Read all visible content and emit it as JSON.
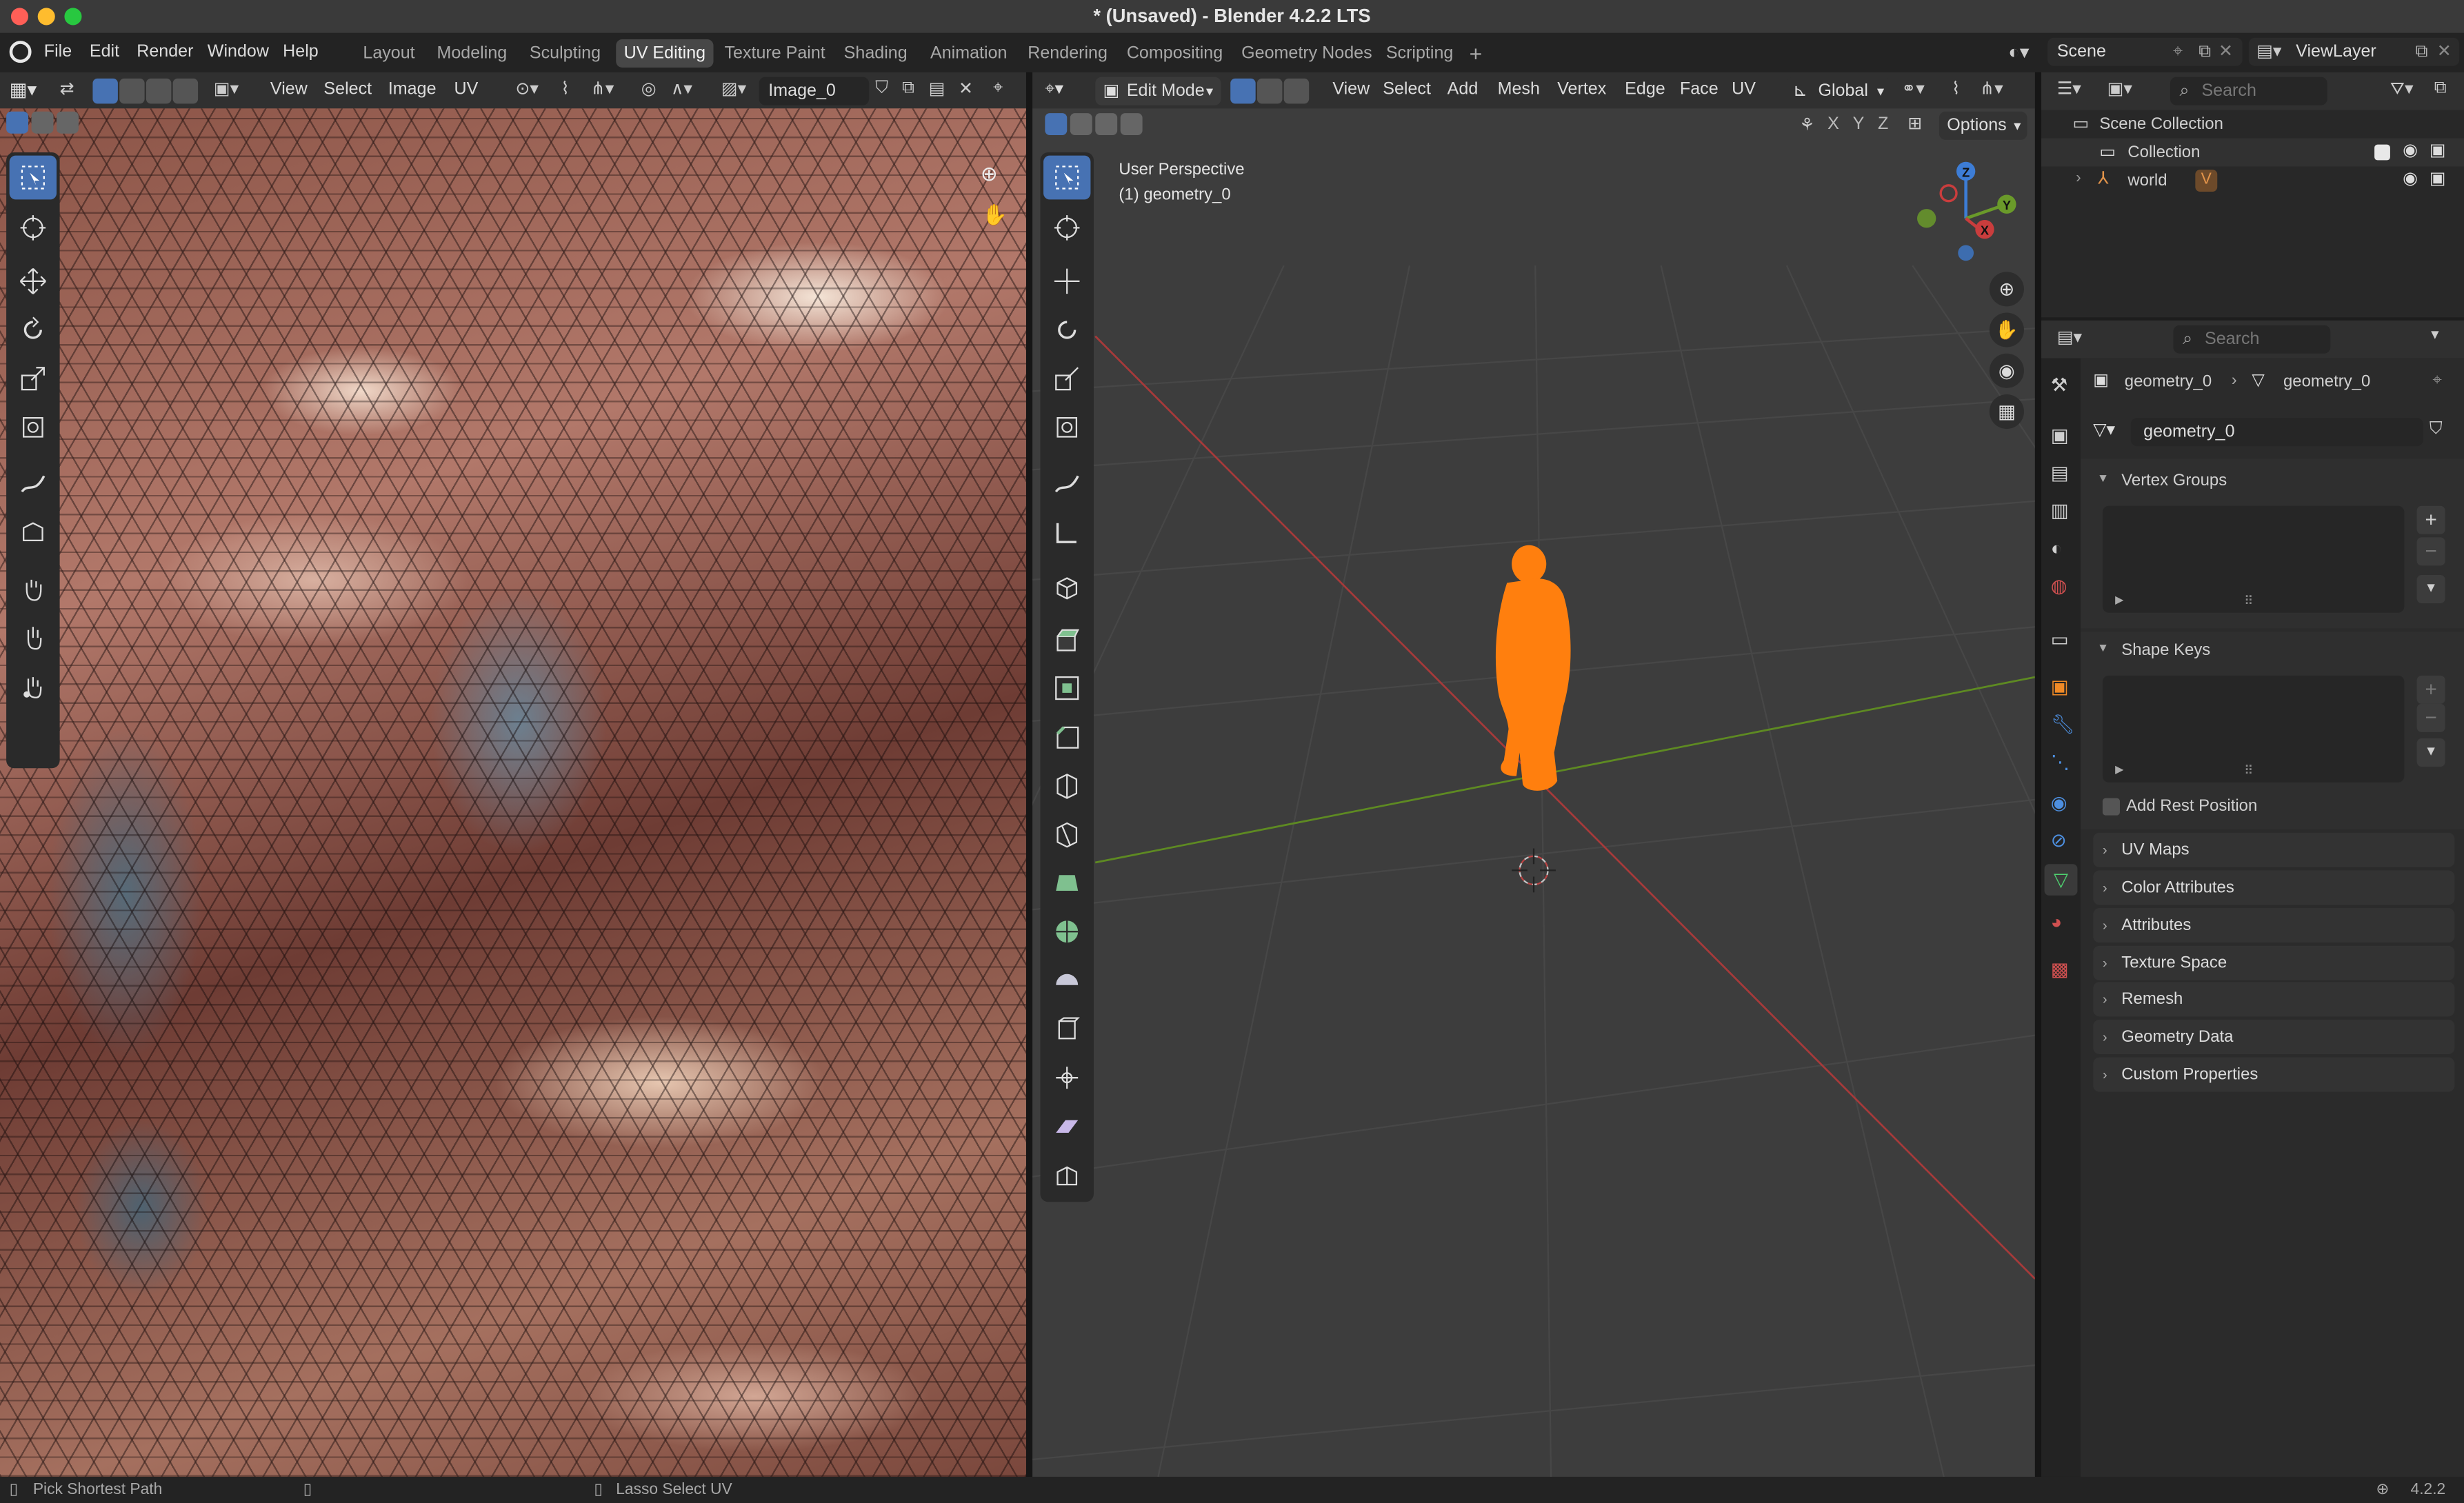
{
  "window": {
    "title": "* (Unsaved) - Blender 4.2.2 LTS"
  },
  "menus": [
    "File",
    "Edit",
    "Render",
    "Window",
    "Help"
  ],
  "workspaces": [
    {
      "label": "Layout",
      "active": false
    },
    {
      "label": "Modeling",
      "active": false
    },
    {
      "label": "Sculpting",
      "active": false
    },
    {
      "label": "UV Editing",
      "active": true
    },
    {
      "label": "Texture Paint",
      "active": false
    },
    {
      "label": "Shading",
      "active": false
    },
    {
      "label": "Animation",
      "active": false
    },
    {
      "label": "Rendering",
      "active": false
    },
    {
      "label": "Compositing",
      "active": false
    },
    {
      "label": "Geometry Nodes",
      "active": false
    },
    {
      "label": "Scripting",
      "active": false
    }
  ],
  "add_workspace": "+",
  "scene": {
    "label": "Scene",
    "view_layer": "ViewLayer"
  },
  "uv_editor": {
    "menus": [
      "View",
      "Select",
      "Image",
      "UV"
    ],
    "image_name": "Image_0"
  },
  "viewport": {
    "mode": "Edit Mode",
    "menus": [
      "View",
      "Select",
      "Add",
      "Mesh",
      "Vertex",
      "Edge",
      "Face",
      "UV"
    ],
    "orientation": "Global",
    "axes": [
      "X",
      "Y",
      "Z"
    ],
    "options": "Options",
    "overlay_title": "User Perspective",
    "overlay_object": "(1) geometry_0",
    "gizmo": {
      "z": "Z",
      "y": "Y",
      "x": "X"
    }
  },
  "outliner": {
    "search_placeholder": "Search",
    "items": {
      "scene_collection": "Scene Collection",
      "collection": "Collection",
      "world": "world"
    }
  },
  "properties": {
    "search_placeholder": "Search",
    "breadcrumb": {
      "object": "geometry_0",
      "mesh": "geometry_0"
    },
    "mesh_name": "geometry_0",
    "vertex_groups": "Vertex Groups",
    "shape_keys": "Shape Keys",
    "add_rest_position": "Add Rest Position",
    "collapsed_panels": [
      "UV Maps",
      "Color Attributes",
      "Attributes",
      "Texture Space",
      "Remesh",
      "Geometry Data",
      "Custom Properties"
    ]
  },
  "statusbar": {
    "left": "Pick Shortest Path",
    "middle": "Lasso Select UV",
    "version": "4.2.2"
  },
  "colors": {
    "accent": "#4772b3",
    "mesh_orange": "#ff7f0e",
    "x_axis": "#c93d3d",
    "y_axis": "#6a9a2a",
    "z_axis": "#3d7dd6"
  }
}
